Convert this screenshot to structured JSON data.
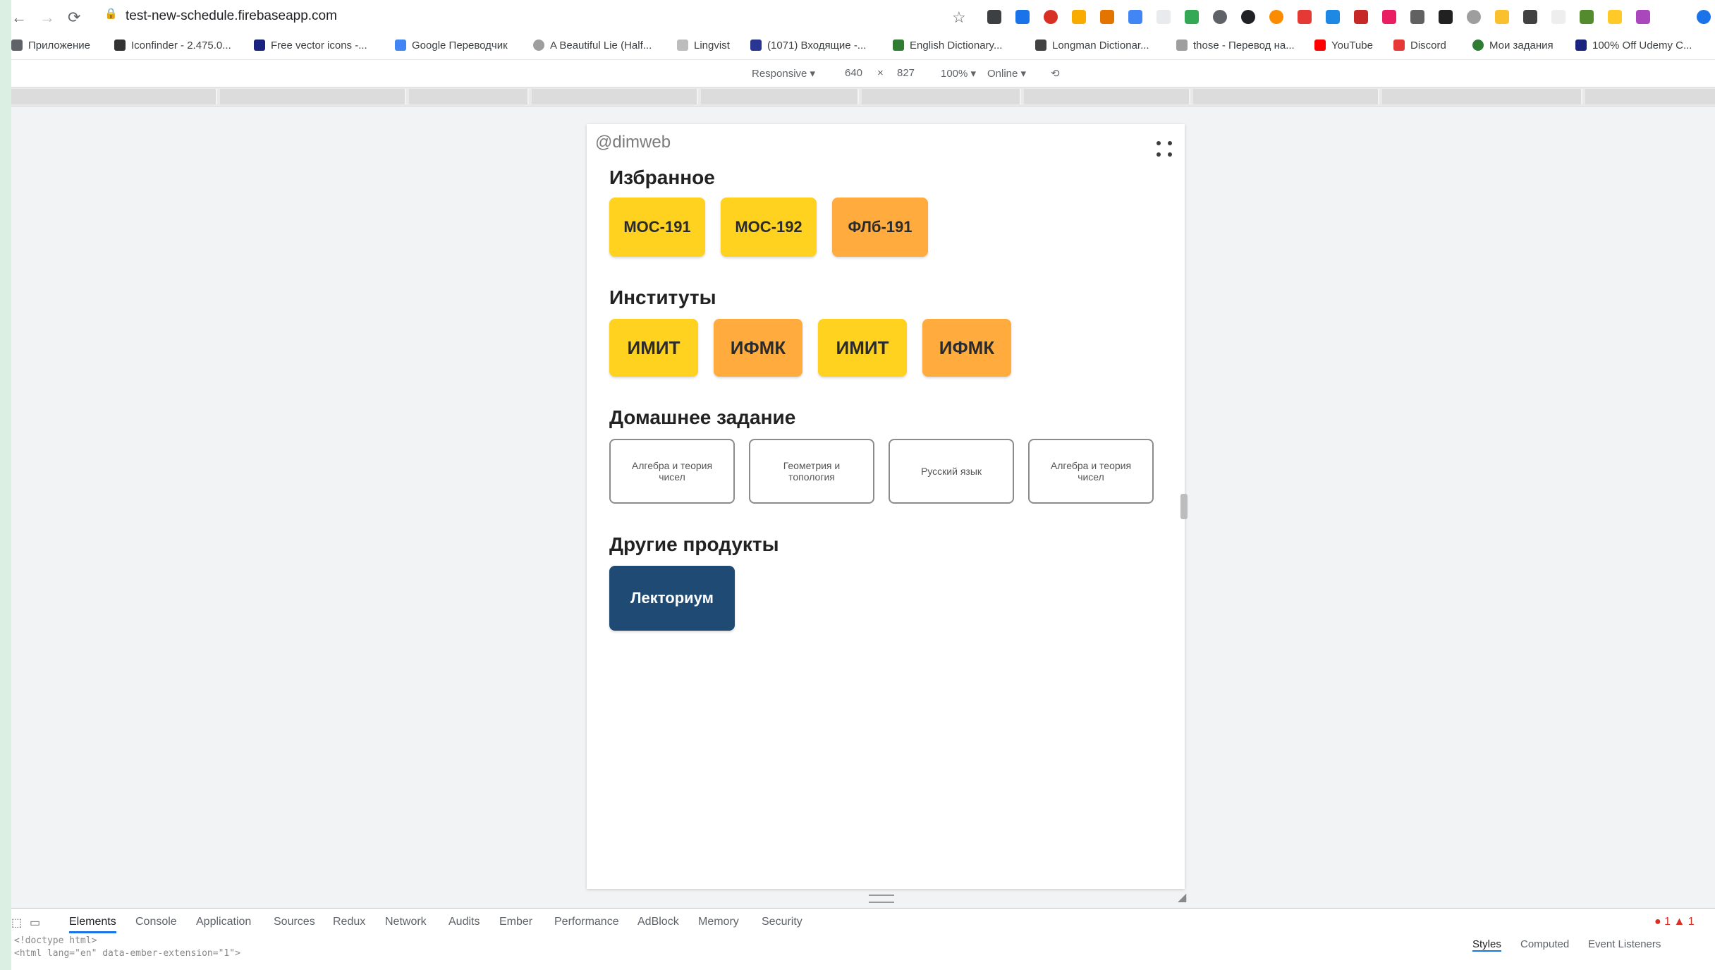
{
  "browser": {
    "url": "test-new-schedule.firebaseapp.com",
    "bookmarks": [
      "Приложение",
      "Iconfinder - 2.475.0...",
      "Free vector icons -...",
      "Google Переводчик",
      "A Beautiful Lie (Half...",
      "Lingvist",
      "(1071) Входящие -...",
      "English Dictionary...",
      "Longman Dictionar...",
      "those - Перевод на...",
      "YouTube",
      "Discord",
      "Мои задания",
      "100% Off Udemy C..."
    ]
  },
  "device_toolbar": {
    "mode": "Responsive ▾",
    "width": "640",
    "sep": "×",
    "height": "827",
    "zoom": "100% ▾",
    "network": "Online ▾"
  },
  "app": {
    "brand": "@dimweb",
    "sections": {
      "favorites": {
        "title": "Избранное",
        "items": [
          "МОС-191",
          "МОС-192",
          "ФЛб-191"
        ]
      },
      "institutes": {
        "title": "Институты",
        "items": [
          "ИМИТ",
          "ИФМК",
          "ИМИТ",
          "ИФМК"
        ]
      },
      "homework": {
        "title": "Домашнее задание",
        "items": [
          "Алгебра и теория чисел",
          "Геометрия и топология",
          "Русский язык",
          "Алгебра и теория чисел"
        ]
      },
      "other": {
        "title": "Другие продукты",
        "items": [
          "Лекториум"
        ]
      }
    }
  },
  "devtools": {
    "tabs": [
      "Elements",
      "Console",
      "Application",
      "Sources",
      "Redux",
      "Network",
      "Audits",
      "Ember",
      "Performance",
      "AdBlock",
      "Memory",
      "Security"
    ],
    "code_lines": [
      "<!doctype html>",
      "<html lang=\"en\" data-ember-extension=\"1\">"
    ],
    "right_tabs": [
      "Styles",
      "Computed",
      "Event Listeners"
    ],
    "badges": "● 1 ▲ 1"
  },
  "colors": {
    "yellow": "#ffd21f",
    "orange": "#ffab3d",
    "navy": "#1f4a73"
  }
}
